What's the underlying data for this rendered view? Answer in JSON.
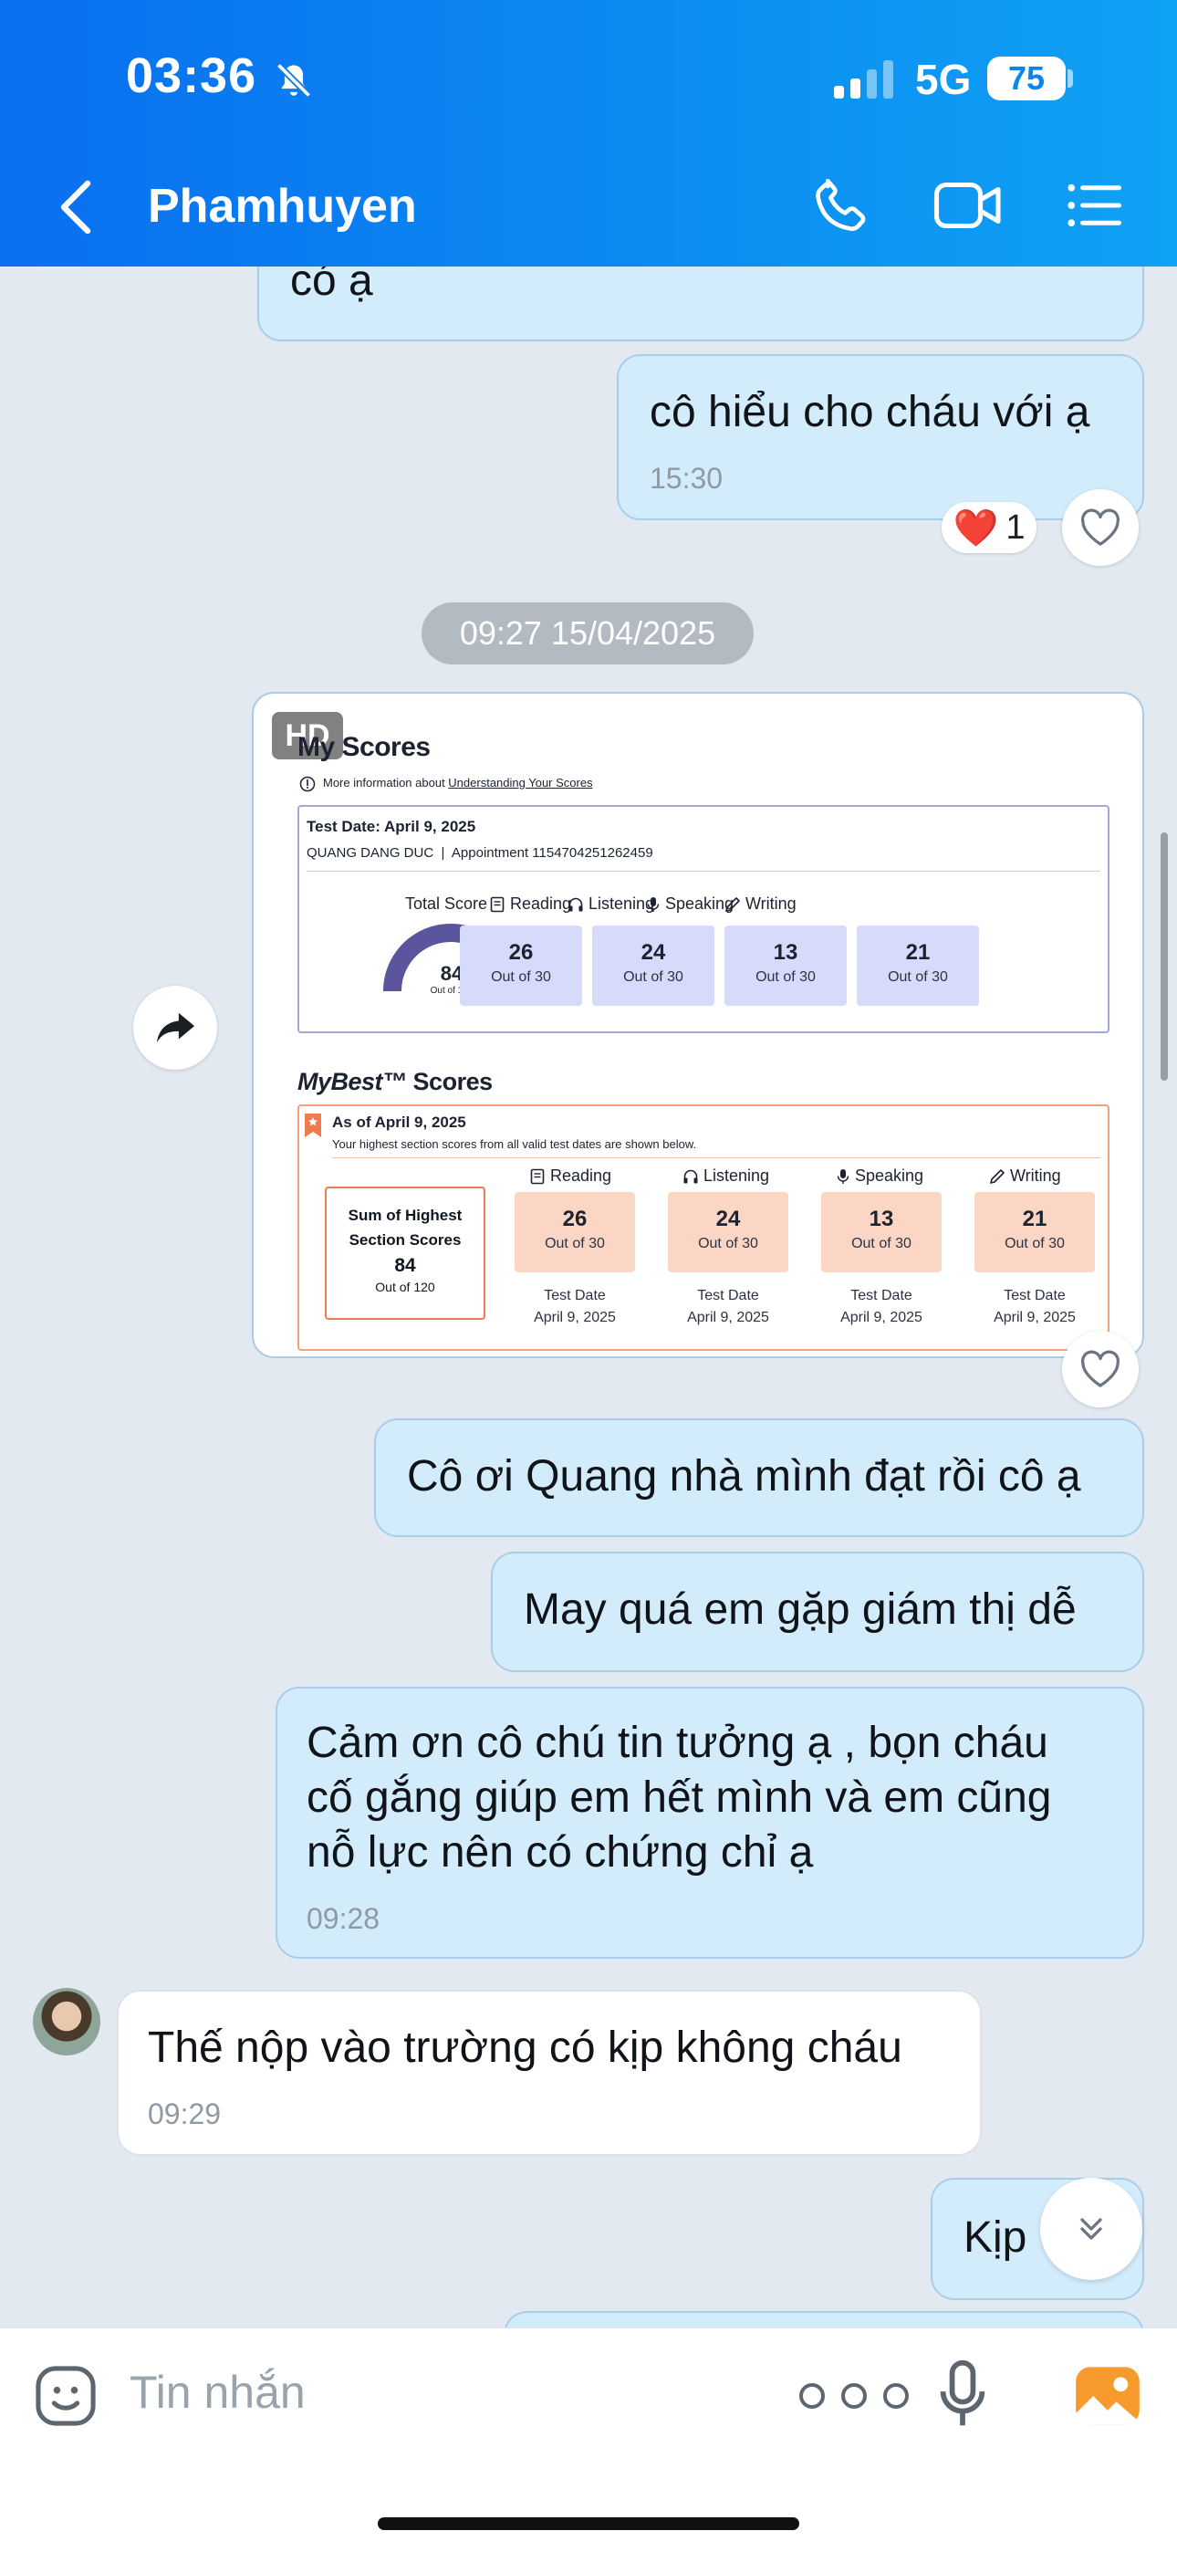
{
  "status_bar": {
    "time": "03:36",
    "network": "5G",
    "battery": "75"
  },
  "header": {
    "contact_name": "Phamhuyen"
  },
  "messages": [
    {
      "text": "có ạ"
    },
    {
      "text": "cô hiểu cho cháu với ạ",
      "time": "15:30",
      "reaction": {
        "emoji": "❤️",
        "count": "1"
      }
    },
    {
      "text": "Cô ơi Quang nhà mình đạt rồi cô ạ"
    },
    {
      "text": "May quá em gặp giám thị dễ"
    },
    {
      "text": "Cảm ơn cô chú tin tưởng ạ , bọn cháu\ncố gắng giúp em hết mình và em cũng\nnỗ lực nên có chứng chỉ ạ",
      "time": "09:28"
    },
    {
      "text": "Thế nộp vào trường có kịp không cháu",
      "time": "09:29"
    },
    {
      "text": "Kịp"
    }
  ],
  "date_separator": "09:27 15/04/2025",
  "image_message": {
    "hd_badge": "HD",
    "report": {
      "title": "My Scores",
      "info_prefix": "More information about ",
      "info_link": "Understanding Your Scores",
      "test_date": "Test Date: April 9, 2025",
      "candidate": "QUANG DANG DUC  |  Appointment 1154704251262459",
      "total_label": "Total Score",
      "total_value": 84,
      "total_max": 120,
      "total_out": "Out of 120",
      "sections": [
        {
          "name": "Reading",
          "score": "26",
          "out": "Out of 30"
        },
        {
          "name": "Listening",
          "score": "24",
          "out": "Out of 30"
        },
        {
          "name": "Speaking",
          "score": "13",
          "out": "Out of 30"
        },
        {
          "name": "Writing",
          "score": "21",
          "out": "Out of 30"
        }
      ],
      "mybest_title": "MyBest™",
      "mybest_suffix": "Scores",
      "as_of": "As of April 9, 2025",
      "as_of_note": "Your highest section scores from all valid test dates are shown below.",
      "sum_l1": "Sum of Highest",
      "sum_l2": "Section Scores",
      "sum_value": "84",
      "sum_out": "Out of 120",
      "best": [
        {
          "name": "Reading",
          "score": "26",
          "out": "Out of 30",
          "date_label": "Test Date",
          "date": "April 9, 2025"
        },
        {
          "name": "Listening",
          "score": "24",
          "out": "Out of 30",
          "date_label": "Test Date",
          "date": "April 9, 2025"
        },
        {
          "name": "Speaking",
          "score": "13",
          "out": "Out of 30",
          "date_label": "Test Date",
          "date": "April 9, 2025"
        },
        {
          "name": "Writing",
          "score": "21",
          "out": "Out of 30",
          "date_label": "Test Date",
          "date": "April 9, 2025"
        }
      ]
    }
  },
  "input": {
    "placeholder": "Tin nhắn"
  },
  "colors": {
    "header_blue": "#0a86f0",
    "outgoing_bubble": "#d3ecfc",
    "gauge": "#5a559c",
    "mybest_accent": "#f07b52"
  }
}
